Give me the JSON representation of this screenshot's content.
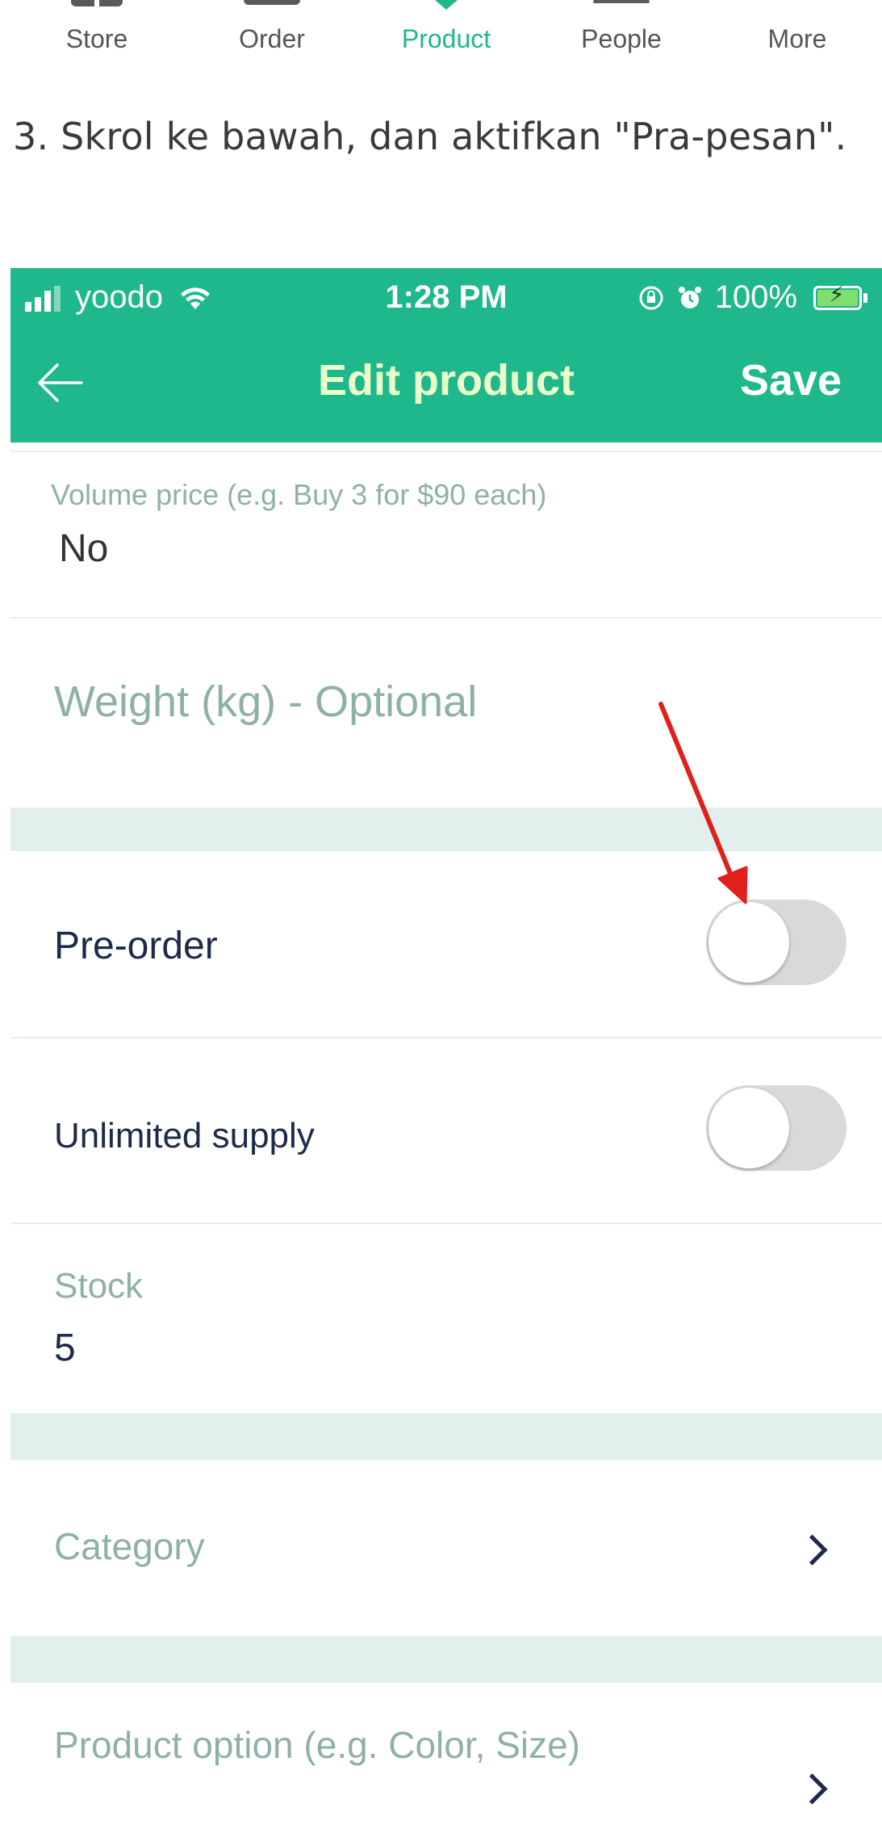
{
  "tabbar": {
    "items": [
      {
        "label": "Store",
        "icon": "store-icon",
        "active": false
      },
      {
        "label": "Order",
        "icon": "order-icon",
        "active": false
      },
      {
        "label": "Product",
        "icon": "product-icon",
        "active": true
      },
      {
        "label": "People",
        "icon": "people-icon",
        "active": false
      },
      {
        "label": "More",
        "icon": "more-icon",
        "active": false
      }
    ],
    "active_color": "#1fb78c"
  },
  "instruction": "3. Skrol ke bawah, dan aktifkan \"Pra-pesan\".",
  "phone": {
    "status_bar": {
      "carrier": "yoodo",
      "time": "1:28 PM",
      "battery": "100%"
    },
    "nav": {
      "title": "Edit product",
      "save_label": "Save",
      "back_icon": "arrow-left-icon"
    },
    "form": {
      "volume_price": {
        "label": "Volume price (e.g. Buy 3 for $90 each)",
        "value": "No"
      },
      "weight": {
        "placeholder": "Weight (kg) - Optional"
      },
      "pre_order": {
        "label": "Pre-order",
        "enabled": false
      },
      "unlimited_supply": {
        "label": "Unlimited supply",
        "enabled": false
      },
      "stock": {
        "label": "Stock",
        "value": "5"
      },
      "category": {
        "label": "Category"
      },
      "product_option": {
        "label": "Product option (e.g. Color, Size)"
      }
    },
    "accent_color": "#1fb78c",
    "annotation_arrow_color": "#e0201b"
  }
}
